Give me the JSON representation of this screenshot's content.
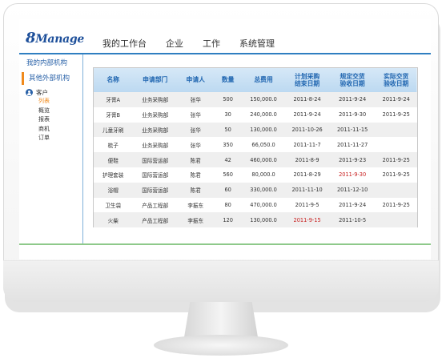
{
  "app": {
    "logo_prefix": "8",
    "logo_text": "Manage"
  },
  "topnav": [
    "我的工作台",
    "企业",
    "工作",
    "系统管理"
  ],
  "sidebar": {
    "orgs": [
      "我的内部机构",
      "其他外部机构"
    ],
    "customer_label": "客户",
    "sub_items": [
      {
        "label": "列表",
        "active": true
      },
      {
        "label": "概览",
        "active": false
      },
      {
        "label": "报表",
        "active": false
      },
      {
        "label": "商机",
        "active": false
      },
      {
        "label": "订单",
        "active": false
      }
    ]
  },
  "table": {
    "headers": [
      "名称",
      "申请部门",
      "申请人",
      "数量",
      "总费用",
      "计划采购\n结束日期",
      "规定交货\n验收日期",
      "实际交货\n验收日期"
    ],
    "rows": [
      [
        "牙膏A",
        "业务采购部",
        "张华",
        "500",
        "150,000.0",
        "2011-8-24",
        "2011-9-24",
        "2011-9-24"
      ],
      [
        "牙膏B",
        "业务采购部",
        "张华",
        "30",
        "240,000.0",
        "2011-9-24",
        "2011-9-30",
        "2011-9-25"
      ],
      [
        "儿童牙刷",
        "业务采购部",
        "张华",
        "50",
        "130,000.0",
        "2011-10-26",
        "2011-11-15",
        ""
      ],
      [
        "梳子",
        "业务采购部",
        "张华",
        "350",
        "66,050.0",
        "2011-11-7",
        "2011-11-27",
        ""
      ],
      [
        "便鞋",
        "国际营运部",
        "陈君",
        "42",
        "460,000.0",
        "2011-8-9",
        "2011-9-23",
        "2011-9-25"
      ],
      [
        "护理套装",
        "国际营运部",
        "陈君",
        "560",
        "80,000.0",
        "2011-8-29",
        "2011-9-30",
        "2011-9-25"
      ],
      [
        "浴帽",
        "国际营运部",
        "陈君",
        "60",
        "330,000.0",
        "2011-11-10",
        "2011-12-10",
        ""
      ],
      [
        "卫生袋",
        "产品工程部",
        "李振东",
        "80",
        "470,000.0",
        "2011-9-5",
        "2011-9-24",
        "2011-9-25"
      ],
      [
        "火柴",
        "产品工程部",
        "李振东",
        "120",
        "130,000.0",
        "2011-9-15",
        "2011-10-5",
        ""
      ]
    ],
    "highlight_color": "#c81e1e",
    "highlights": [
      [
        5,
        6
      ],
      [
        8,
        5
      ]
    ]
  },
  "colors": {
    "accent": "#2f7fc1",
    "active": "#f08a1c",
    "footer_line": "#8ec98a"
  }
}
